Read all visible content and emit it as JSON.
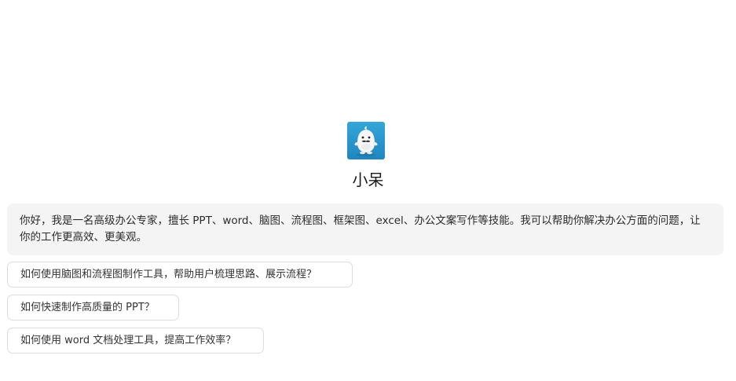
{
  "bot": {
    "name": "小呆",
    "avatar_icon": "white-cartoon-mascot-icon",
    "avatar_bg": "#2a96cc"
  },
  "intro": {
    "text": "你好，我是一名高级办公专家，擅长 PPT、word、脑图、流程图、框架图、excel、办公文案写作等技能。我可以帮助你解决办公方面的问题，让你的工作更高效、更美观。"
  },
  "suggestions": [
    "如何使用脑图和流程图制作工具，帮助用户梳理思路、展示流程？",
    "如何快速制作高质量的 PPT？",
    "如何使用 word 文档处理工具，提高工作效率？"
  ]
}
